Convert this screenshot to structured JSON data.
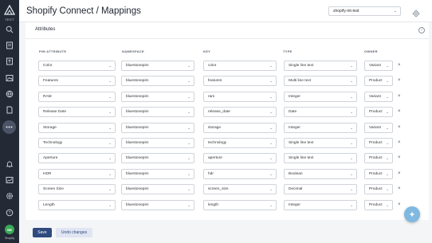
{
  "sidebar": {
    "org_label": "TEST",
    "avatar_initials": "BB",
    "user_label": "Shopify"
  },
  "header": {
    "title": "Shopify Connect / Mappings",
    "store_select": "shopify-int-test"
  },
  "section": {
    "title": "Attributes",
    "info_glyph": "i"
  },
  "columns": {
    "attribute": "PIM ATTRIBUTE",
    "namespace": "NAMESPACE",
    "key": "KEY",
    "type": "TYPE",
    "owner": "OWNER"
  },
  "mappings": [
    {
      "attribute": "Color",
      "namespace": "bluestonepim",
      "key": "color",
      "type": "Single line text",
      "owner": "Variant"
    },
    {
      "attribute": "Features",
      "namespace": "bluestonepim",
      "key": "features",
      "type": "Multi line text",
      "owner": "Product"
    },
    {
      "attribute": "RAM",
      "namespace": "bluestonepim",
      "key": "ram",
      "type": "Integer",
      "owner": "Variant"
    },
    {
      "attribute": "Release Date",
      "namespace": "bluestonepim",
      "key": "release_date",
      "type": "Date",
      "owner": "Product"
    },
    {
      "attribute": "Storage",
      "namespace": "bluestonepim",
      "key": "storage",
      "type": "Integer",
      "owner": "Variant"
    },
    {
      "attribute": "Technology",
      "namespace": "bluestonepim",
      "key": "technology",
      "type": "Single line text",
      "owner": "Product"
    },
    {
      "attribute": "Aperture",
      "namespace": "bluestonepim",
      "key": "aperture",
      "type": "Single line text",
      "owner": "Product"
    },
    {
      "attribute": "HDR",
      "namespace": "bluestonepim",
      "key": "hdr",
      "type": "Boolean",
      "owner": "Product"
    },
    {
      "attribute": "Screen Size",
      "namespace": "bluestonepim",
      "key": "screen_size",
      "type": "Decimal",
      "owner": "Product"
    },
    {
      "attribute": "Length",
      "namespace": "bluestonepim",
      "key": "length",
      "type": "Integer",
      "owner": "Product"
    }
  ],
  "row_controls": {
    "chevron": "⌄",
    "remove": "×"
  },
  "footer": {
    "save_label": "Save",
    "undo_label": "Undo changes"
  },
  "colors": {
    "sidebar_bg": "#232a36",
    "primary": "#2f4b7f",
    "secondary_bg": "#dfe5f2",
    "fab": "#7fb8e0",
    "avatar": "#3aa858"
  }
}
